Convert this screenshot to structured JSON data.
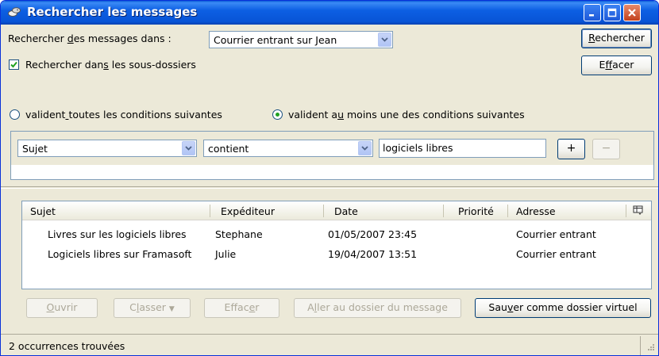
{
  "window": {
    "title": "Rechercher les messages"
  },
  "search_in": {
    "label_pre": "Rechercher ",
    "label_u": "d",
    "label_post": "es messages dans :",
    "selected": "Courrier entrant sur Jean"
  },
  "subfolders": {
    "checked": true,
    "label_pre": "Rechercher dan",
    "label_u": "s",
    "label_post": " les sous-dossiers"
  },
  "match": {
    "all_pre": "valident",
    "all_u": " ",
    "all_post": "toutes les conditions suivantes",
    "any_pre": "valident a",
    "any_u": "u",
    "any_post": " moins une des conditions suivantes",
    "selected": "any"
  },
  "buttons": {
    "search_u": "R",
    "search_rest": "echercher",
    "clear_pre": "E",
    "clear_u": "f",
    "clear_post": "facer"
  },
  "criterion": {
    "field": "Sujet",
    "operator": "contient",
    "value": "logiciels libres",
    "add": "+",
    "remove": "−"
  },
  "results": {
    "columns": [
      "Sujet",
      "Expéditeur",
      "Date",
      "Priorité",
      "Adresse"
    ],
    "rows": [
      {
        "subject": "Livres sur les logiciels libres",
        "sender": "Stephane",
        "date": "01/05/2007 23:45",
        "priority": "",
        "address": "Courrier entrant"
      },
      {
        "subject": "Logiciels libres sur Framasoft",
        "sender": "Julie",
        "date": "19/04/2007 13:51",
        "priority": "",
        "address": "Courrier entrant"
      }
    ]
  },
  "actions": {
    "open_u": "O",
    "open_rest": "uvrir",
    "file_pre": "C",
    "file_u": "l",
    "file_post": "asser",
    "delete_pre": "Effac",
    "delete_u": "e",
    "delete_post": "r",
    "goto_pre": "A",
    "goto_u": "l",
    "goto_post": "ler au dossier du message",
    "save_pre": "Sau",
    "save_u": "v",
    "save_post": "er comme dossier virtuel"
  },
  "status": {
    "text": "2 occurrences trouvées"
  },
  "colors": {
    "title_bar": "#0854d6",
    "window_bg": "#ece9d8",
    "disabled_text": "#aca899"
  }
}
